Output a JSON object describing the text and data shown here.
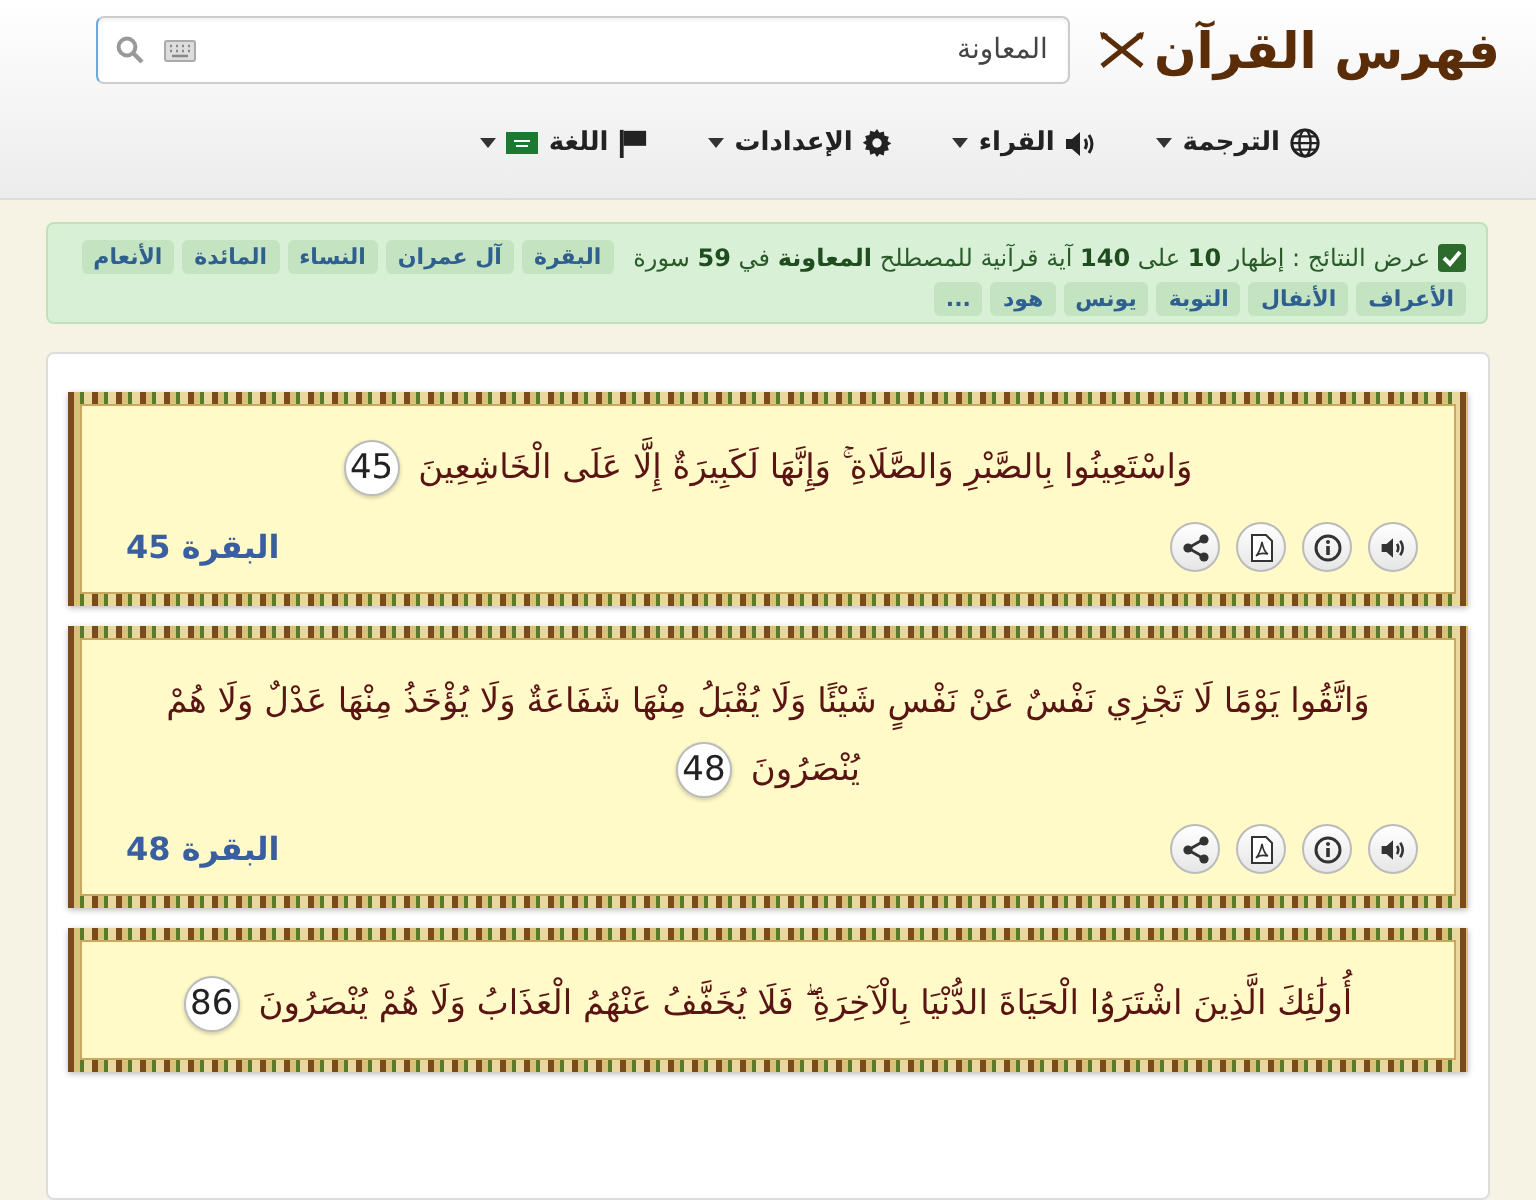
{
  "header": {
    "logo": "فهرس القرآن",
    "search": {
      "value": "المعاونة"
    }
  },
  "nav": [
    {
      "kind": "globe",
      "label": "الترجمة"
    },
    {
      "kind": "speaker",
      "label": "القراء"
    },
    {
      "kind": "gear",
      "label": "الإعدادات"
    },
    {
      "kind": "flag",
      "label": "اللغة"
    }
  ],
  "results": {
    "summary": "عرض النتائج : إظهار **10** على **140** آية قرآنية للمصطلح **المعاونة** في **59** سورة",
    "tags": [
      "البقرة",
      "آل عمران",
      "النساء",
      "المائدة",
      "الأنعام",
      "الأعراف",
      "الأنفال",
      "التوبة",
      "يونس",
      "هود",
      "..."
    ]
  },
  "verses": [
    {
      "text": "وَاسْتَعِينُوا بِالصَّبْرِ وَالصَّلَاةِ ۚ وَإِنَّهَا لَكَبِيرَةٌ إِلَّا عَلَى الْخَاشِعِينَ",
      "number": "45",
      "reference": "البقرة 45"
    },
    {
      "text": "وَاتَّقُوا يَوْمًا لَا تَجْزِي نَفْسٌ عَنْ نَفْسٍ شَيْئًا وَلَا يُقْبَلُ مِنْهَا شَفَاعَةٌ وَلَا يُؤْخَذُ مِنْهَا عَدْلٌ وَلَا هُمْ يُنْصَرُونَ",
      "number": "48",
      "reference": "البقرة 48"
    },
    {
      "text": "أُولَٰئِكَ الَّذِينَ اشْتَرَوُا الْحَيَاةَ الدُّنْيَا بِالْآخِرَةِ ۖ فَلَا يُخَفَّفُ عَنْهُمُ الْعَذَابُ وَلَا هُمْ يُنْصَرُونَ",
      "number": "86"
    }
  ]
}
